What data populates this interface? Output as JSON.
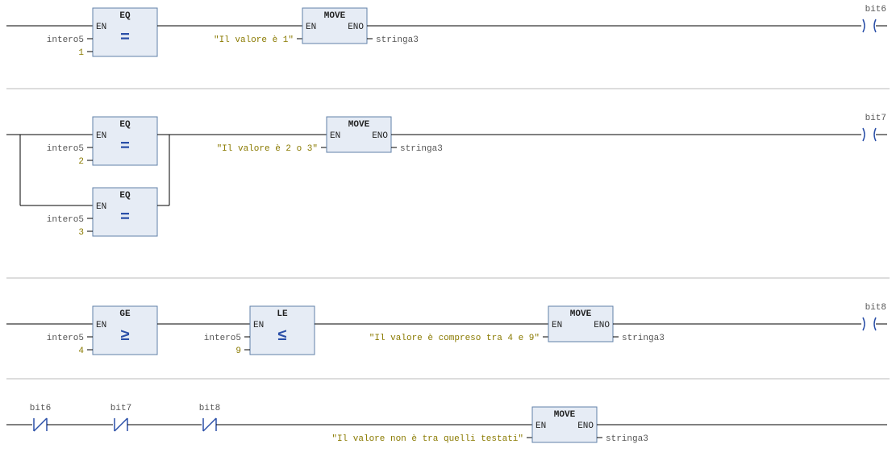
{
  "rung1": {
    "eq": {
      "title": "EQ",
      "en": "EN",
      "op": "=",
      "in1": "intero5",
      "in2": "1"
    },
    "move": {
      "title": "MOVE",
      "en": "EN",
      "eno": "ENO",
      "in": "\"Il valore è 1\"",
      "out": "stringa3"
    },
    "coil": "bit6"
  },
  "rung2": {
    "eq1": {
      "title": "EQ",
      "en": "EN",
      "op": "=",
      "in1": "intero5",
      "in2": "2"
    },
    "eq2": {
      "title": "EQ",
      "en": "EN",
      "op": "=",
      "in1": "intero5",
      "in2": "3"
    },
    "move": {
      "title": "MOVE",
      "en": "EN",
      "eno": "ENO",
      "in": "\"Il valore è 2 o 3\"",
      "out": "stringa3"
    },
    "coil": "bit7"
  },
  "rung3": {
    "ge": {
      "title": "GE",
      "en": "EN",
      "op": "≥",
      "in1": "intero5",
      "in2": "4"
    },
    "le": {
      "title": "LE",
      "en": "EN",
      "op": "≤",
      "in1": "intero5",
      "in2": "9"
    },
    "move": {
      "title": "MOVE",
      "en": "EN",
      "eno": "ENO",
      "in": "\"Il valore è compreso tra 4 e 9\"",
      "out": "stringa3"
    },
    "coil": "bit8"
  },
  "rung4": {
    "contacts": [
      {
        "label": "bit6",
        "nc": true
      },
      {
        "label": "bit7",
        "nc": true
      },
      {
        "label": "bit8",
        "nc": true
      }
    ],
    "move": {
      "title": "MOVE",
      "en": "EN",
      "eno": "ENO",
      "in": "\"Il valore non è tra quelli testati\"",
      "out": "stringa3"
    }
  }
}
